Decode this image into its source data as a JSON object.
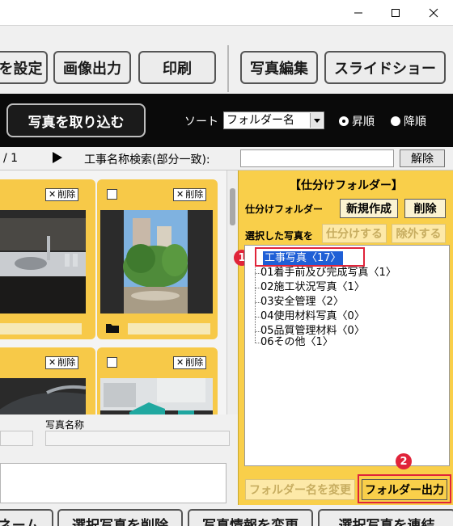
{
  "toolbar": {
    "buttons": [
      "を設定",
      "画像出力",
      "印刷",
      "写真編集",
      "スライドショー"
    ]
  },
  "import_bar": {
    "import_label": "写真を取り込む",
    "sort_label": "ソート",
    "sort_value": "フォルダー名",
    "radio_asc": "昇順",
    "radio_desc": "降順",
    "selected_order": "ascending"
  },
  "search_bar": {
    "page": "/ 1",
    "search_label": "工事名称検索(部分一致):",
    "search_value": "",
    "clear_label": "解除"
  },
  "photos": {
    "delete_label": "削除",
    "delete_mark": "✕"
  },
  "info": {
    "photo_name_label": "写真名称"
  },
  "panel": {
    "title": "【仕分けフォルダー】",
    "folder_label": "仕分けフォルダー",
    "new_label": "新規作成",
    "delete_label": "削除",
    "selected_label": "選択した写真を",
    "sort_btn": "仕分けする",
    "exclude_btn": "除外する",
    "rename_btn": "フォルダー名を変更",
    "output_btn": "フォルダー出力",
    "root": "工事写真〈17〉",
    "tree": [
      "01着手前及び完成写真〈1〉",
      "02施工状況写真〈1〉",
      "03安全管理〈2〉",
      "04使用材料写真〈0〉",
      "05品質管理材料〈0〉",
      "06その他〈1〉"
    ],
    "marker1": "1",
    "marker2": "2"
  },
  "bottom": {
    "buttons": [
      "ネーム",
      "選択写真を削除",
      "写真情報を変更",
      "選択写真を連結"
    ]
  },
  "colors": {
    "panel_yellow": "#f9cf4a",
    "card_yellow": "#f7c948",
    "highlight_red": "#e0243a",
    "selection_blue": "#1f5fd6"
  }
}
